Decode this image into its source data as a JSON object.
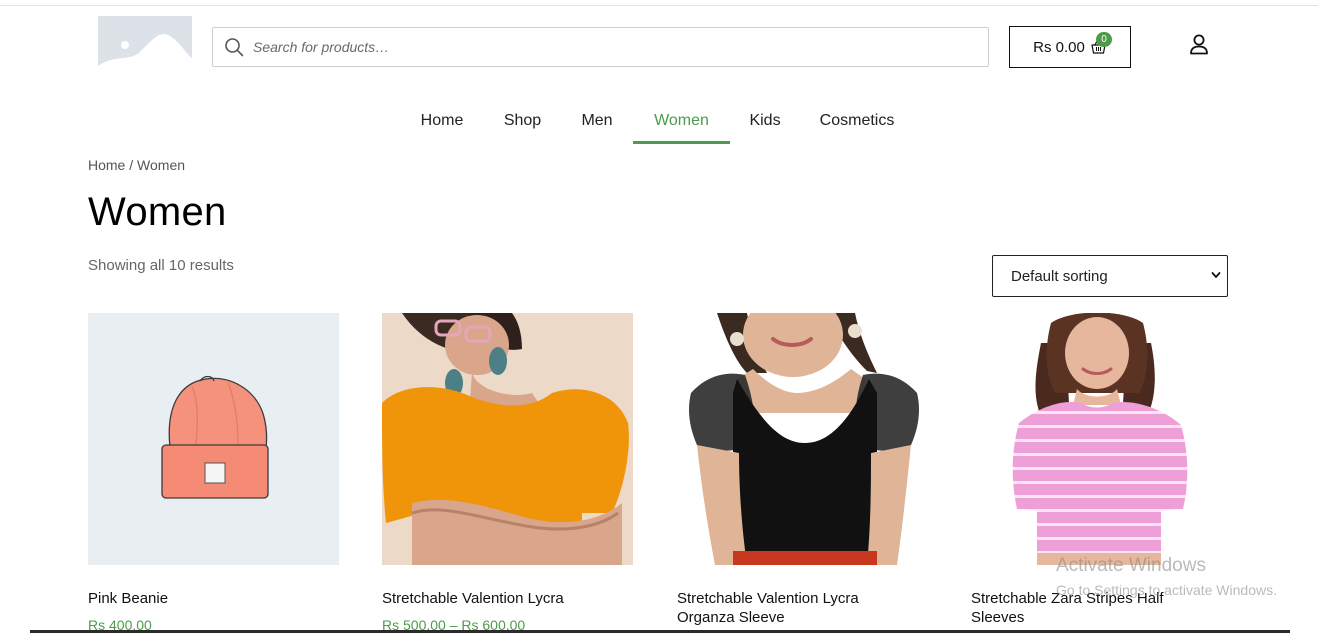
{
  "header": {
    "search": {
      "placeholder": "Search for products…"
    },
    "cart": {
      "total": "Rs 0.00",
      "count": "0"
    }
  },
  "nav": {
    "items": [
      {
        "label": "Home"
      },
      {
        "label": "Shop"
      },
      {
        "label": "Men"
      },
      {
        "label": "Women",
        "active": true
      },
      {
        "label": "Kids"
      },
      {
        "label": "Cosmetics"
      }
    ]
  },
  "breadcrumb": {
    "home": "Home",
    "separator": " / ",
    "current": "Women"
  },
  "page": {
    "title": "Women",
    "result_count": "Showing all 10 results",
    "sorting": {
      "selected": "Default sorting"
    }
  },
  "products": [
    {
      "name": "Pink Beanie",
      "price": "Rs 400.00"
    },
    {
      "name": "Stretchable Valention Lycra",
      "price": "Rs 500.00 – Rs 600.00"
    },
    {
      "name": "Stretchable Valention Lycra Organza Sleeve",
      "price": ""
    },
    {
      "name": "Stretchable Zara Stripes Half Sleeves",
      "price": ""
    }
  ],
  "watermark": {
    "title": "Activate Windows",
    "subtitle": "Go to Settings to activate Windows."
  },
  "colors": {
    "accent": "#4d9b4b",
    "text": "#222222",
    "muted": "#666666"
  }
}
